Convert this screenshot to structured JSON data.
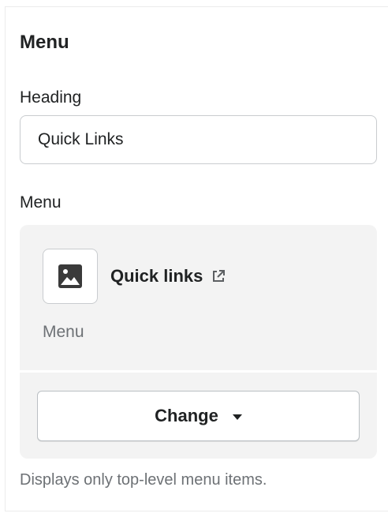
{
  "section": {
    "title": "Menu"
  },
  "heading_field": {
    "label": "Heading",
    "value": "Quick Links"
  },
  "menu_field": {
    "label": "Menu",
    "selected_menu": {
      "name": "Quick links",
      "type": "Menu",
      "thumbnail_icon": "image-icon",
      "link_icon": "external-link-icon"
    },
    "change_button": {
      "label": "Change",
      "icon": "caret-down-icon"
    },
    "help_text": "Displays only top-level menu items."
  },
  "colors": {
    "text": "#202223",
    "subdued_text": "#6d7175",
    "card_background": "#f3f3f3",
    "border": "#c9cccf"
  }
}
